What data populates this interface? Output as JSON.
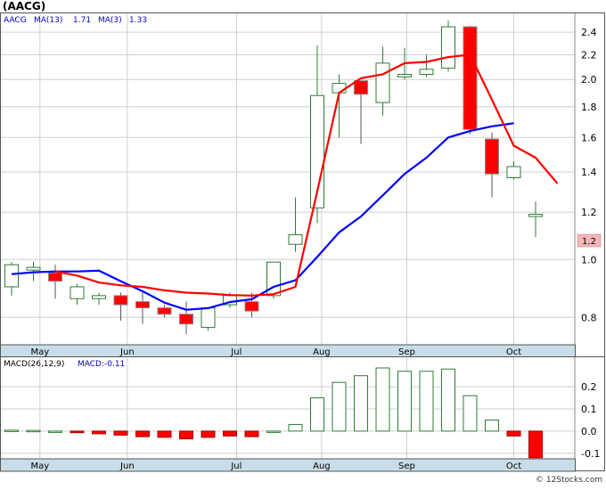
{
  "colors": {
    "up": "#2e7d32",
    "down": "#ff0000",
    "ma13": "#0000ff",
    "ma3": "#ff0000",
    "grid": "#cfcfcf",
    "axis_band": "#c8dde8",
    "last_price_box": "#f4b6b6",
    "text_blue": "#0000cc"
  },
  "price_panel": {
    "ticker": "(AACG)",
    "legend_symbol": "AACG",
    "ma13_label": "MA(13)",
    "ma13_value": "1.71",
    "ma3_label": "MA(3)",
    "ma3_value": "1.33",
    "last_price_label": "1.2"
  },
  "macd_panel": {
    "label": "MACD(26,12,9)",
    "value_label": "MACD:-0.11"
  },
  "watermark": "© 12Stocks.com",
  "chart_data": [
    {
      "type": "candlestick",
      "title": "(AACG)",
      "scale": "log",
      "ylim": [
        0.72,
        2.58
      ],
      "y_ticks": [
        0.8,
        1.0,
        1.2,
        1.4,
        1.6,
        1.8,
        2.0,
        2.2,
        2.4
      ],
      "y_tick_labels": [
        "0.8",
        "1.0",
        "1.2",
        "1.4",
        "1.6",
        "1.8",
        "2.0",
        "2.2",
        "2.4"
      ],
      "x_month_labels": [
        {
          "label": "May",
          "index": 1.3
        },
        {
          "label": "Jun",
          "index": 5.3
        },
        {
          "label": "Jul",
          "index": 10.3
        },
        {
          "label": "Aug",
          "index": 14.2
        },
        {
          "label": "Sep",
          "index": 18.1
        },
        {
          "label": "Oct",
          "index": 23.0
        }
      ],
      "grid": true,
      "candles": [
        {
          "open": 0.9,
          "high": 0.99,
          "low": 0.87,
          "close": 0.98
        },
        {
          "open": 0.96,
          "high": 0.99,
          "low": 0.92,
          "close": 0.97
        },
        {
          "open": 0.95,
          "high": 0.98,
          "low": 0.86,
          "close": 0.92
        },
        {
          "open": 0.86,
          "high": 0.91,
          "low": 0.84,
          "close": 0.9
        },
        {
          "open": 0.86,
          "high": 0.88,
          "low": 0.84,
          "close": 0.87
        },
        {
          "open": 0.87,
          "high": 0.88,
          "low": 0.79,
          "close": 0.84
        },
        {
          "open": 0.85,
          "high": 0.88,
          "low": 0.78,
          "close": 0.83
        },
        {
          "open": 0.83,
          "high": 0.84,
          "low": 0.8,
          "close": 0.81
        },
        {
          "open": 0.81,
          "high": 0.85,
          "low": 0.75,
          "close": 0.78
        },
        {
          "open": 0.77,
          "high": 0.83,
          "low": 0.76,
          "close": 0.83
        },
        {
          "open": 0.84,
          "high": 0.88,
          "low": 0.83,
          "close": 0.87
        },
        {
          "open": 0.85,
          "high": 0.88,
          "low": 0.8,
          "close": 0.82
        },
        {
          "open": 0.87,
          "high": 0.92,
          "low": 0.86,
          "close": 0.99
        },
        {
          "open": 1.06,
          "high": 1.27,
          "low": 1.03,
          "close": 1.1
        },
        {
          "open": 1.22,
          "high": 2.28,
          "low": 1.15,
          "close": 1.88
        },
        {
          "open": 1.9,
          "high": 2.04,
          "low": 1.6,
          "close": 1.97
        },
        {
          "open": 1.99,
          "high": 1.99,
          "low": 1.56,
          "close": 1.89
        },
        {
          "open": 1.83,
          "high": 2.27,
          "low": 1.74,
          "close": 2.13
        },
        {
          "open": 2.02,
          "high": 2.26,
          "low": 2.0,
          "close": 2.04
        },
        {
          "open": 2.04,
          "high": 2.2,
          "low": 2.02,
          "close": 2.08
        },
        {
          "open": 2.09,
          "high": 2.51,
          "low": 2.06,
          "close": 2.45
        },
        {
          "open": 2.45,
          "high": 2.46,
          "low": 1.62,
          "close": 1.65
        },
        {
          "open": 1.59,
          "high": 1.63,
          "low": 1.27,
          "close": 1.39
        },
        {
          "open": 1.37,
          "high": 1.46,
          "low": 1.36,
          "close": 1.43
        },
        {
          "open": 1.18,
          "high": 1.25,
          "low": 1.09,
          "close": 1.19
        }
      ],
      "series": [
        {
          "name": "MA(13)",
          "color": "#0000ff",
          "start_index": 0,
          "values": [
            0.945,
            0.952,
            0.955,
            0.955,
            0.958,
            0.92,
            0.885,
            0.847,
            0.824,
            0.829,
            0.849,
            0.858,
            0.9,
            0.923,
            1.01,
            1.11,
            1.18,
            1.28,
            1.39,
            1.48,
            1.6,
            1.64,
            1.67,
            1.69
          ]
        },
        {
          "name": "MA(3)",
          "color": "#ff0000",
          "start_index": 2,
          "values": [
            0.955,
            0.94,
            0.915,
            0.905,
            0.9,
            0.888,
            0.88,
            0.877,
            0.872,
            0.87,
            0.875,
            0.9,
            1.3,
            1.9,
            2.01,
            2.04,
            2.13,
            2.14,
            2.18,
            2.2,
            1.85,
            1.55,
            1.48,
            1.34
          ]
        }
      ]
    },
    {
      "type": "bar",
      "title": "MACD(26,12,9)",
      "ylim": [
        -0.125,
        0.285
      ],
      "y_ticks": [
        -0.1,
        0.0,
        0.1,
        0.2
      ],
      "y_tick_labels": [
        "-0.1",
        "0.0",
        "0.1",
        "0.2"
      ],
      "grid": true,
      "series": [
        {
          "name": "MACD",
          "values": [
            0.004,
            0.003,
            0.0,
            -0.007,
            -0.012,
            -0.018,
            -0.025,
            -0.028,
            -0.035,
            -0.028,
            -0.022,
            -0.025,
            0.0,
            0.03,
            0.15,
            0.22,
            0.25,
            0.285,
            0.27,
            0.27,
            0.28,
            0.16,
            0.05,
            -0.022,
            -0.12
          ]
        }
      ],
      "x_month_labels": [
        {
          "label": "May",
          "index": 1.3
        },
        {
          "label": "Jun",
          "index": 5.3
        },
        {
          "label": "Jul",
          "index": 10.3
        },
        {
          "label": "Aug",
          "index": 14.2
        },
        {
          "label": "Sep",
          "index": 18.1
        },
        {
          "label": "Oct",
          "index": 23.0
        }
      ]
    }
  ]
}
